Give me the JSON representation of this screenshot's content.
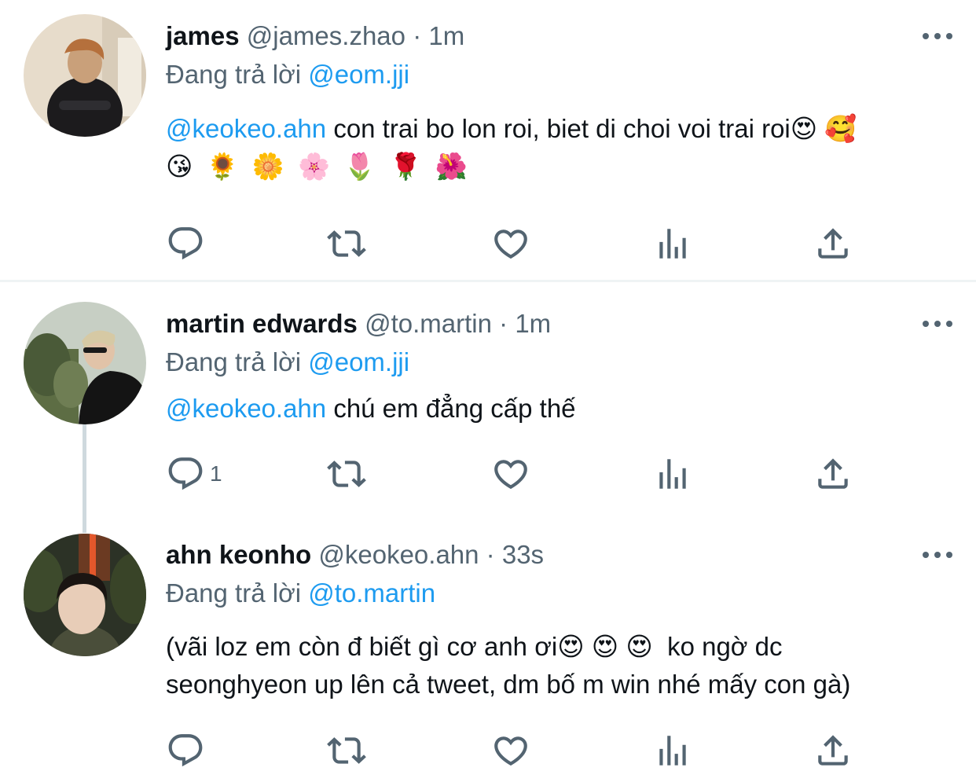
{
  "tweets": [
    {
      "name": "james",
      "handle": "@james.zhao",
      "time": "1m",
      "replying_prefix": "Đang trả lời",
      "replying_to": "@eom.jji",
      "mention": "@keokeo.ahn",
      "text": "con trai bo lon roi, biet di choi voi trai roi",
      "emoji_line1": "😍 🥰",
      "emoji_line2": "😘 🌻 🌼 🌸 🌷 🌹 🌺",
      "reply_count": ""
    },
    {
      "name": "martin edwards",
      "handle": "@to.martin",
      "time": "1m",
      "replying_prefix": "Đang trả lời",
      "replying_to": "@eom.jji",
      "mention": "@keokeo.ahn",
      "text": "chú em đẳng cấp thế",
      "reply_count": "1"
    },
    {
      "name": "ahn keonho",
      "handle": "@keokeo.ahn",
      "time": "33s",
      "replying_prefix": "Đang trả lời",
      "replying_to": "@to.martin",
      "line1": "(vãi loz em còn đ biết gì cơ anh ơi",
      "line1_emoji": "😍 😍 😍",
      "line1_end": "ko ngờ dc",
      "line2": "seonghyeon up lên cả tweet, dm bố m win nhé mấy con gà)",
      "reply_count": ""
    }
  ],
  "icons": [
    "reply-icon",
    "retweet-icon",
    "like-icon",
    "views-icon",
    "share-icon",
    "more-icon"
  ],
  "colors": {
    "link": "#1d9bf0",
    "secondary": "#536471",
    "text": "#0f1419",
    "divider": "#eff3f4"
  }
}
